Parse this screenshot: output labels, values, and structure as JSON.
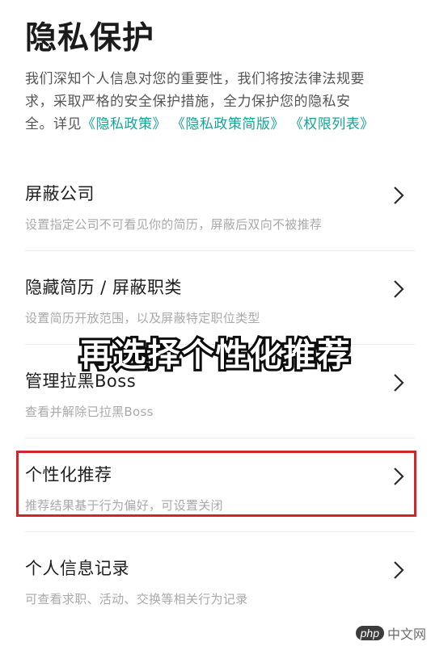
{
  "header": {
    "title": "隐私保护",
    "description_line1": "我们深知个人信息对您的重要性，我们将按法律法规要",
    "description_line2": "求，采取严格的安全保护措施，全力保护您的隐私安",
    "description_line3_prefix": "全。详见",
    "links": [
      "《隐私政策》",
      "《隐私政策简版》",
      "《权限列表》"
    ]
  },
  "rows": [
    {
      "title": "屏蔽公司",
      "subtitle": "设置指定公司不可看见你的简历，屏蔽后双向不被推荐"
    },
    {
      "title": "隐藏简历 / 屏蔽职类",
      "subtitle": "设置简历开放范围，以及屏蔽特定职位类型"
    },
    {
      "title": "管理拉黑Boss",
      "subtitle": "查看并解除已拉黑Boss"
    },
    {
      "title": "个性化推荐",
      "subtitle": "推荐结果基于行为偏好，可设置关闭"
    },
    {
      "title": "个人信息记录",
      "subtitle": "可查看求职、活动、交换等相关行为记录"
    }
  ],
  "overlay": {
    "caption": "再选择个性化推荐"
  },
  "watermark": {
    "badge": "php",
    "text": "中文网"
  },
  "colors": {
    "link": "#17a398",
    "highlight_border": "#d3242b"
  },
  "icons": {
    "row_arrow": "chevron-right-icon"
  }
}
